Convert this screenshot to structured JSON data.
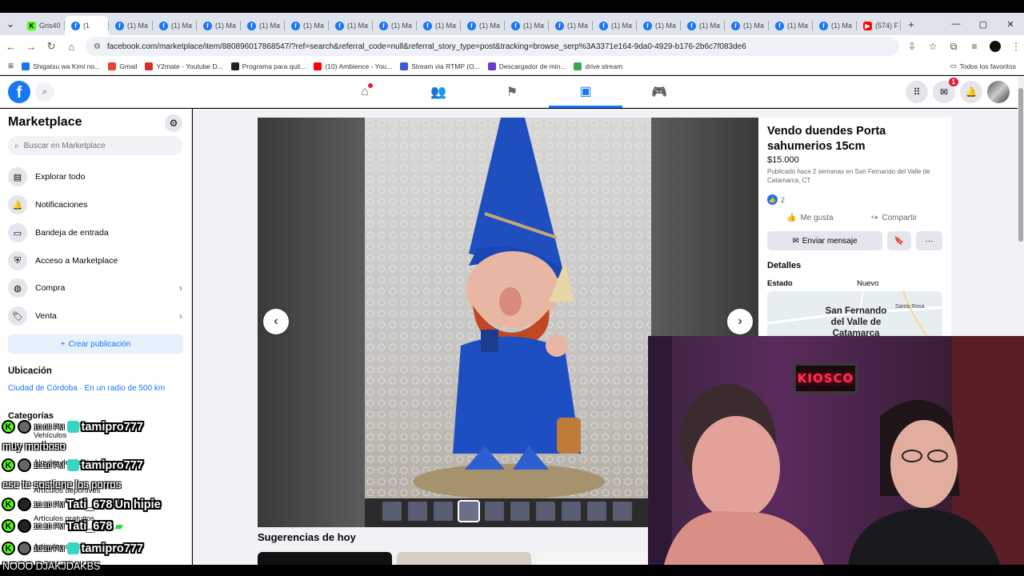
{
  "browser": {
    "tabs": [
      {
        "label": "Gris40",
        "icon": "kick"
      },
      {
        "label": "(1",
        "icon": "facebook",
        "active": true
      },
      {
        "label": "(1) Ma",
        "icon": "facebook"
      },
      {
        "label": "(1) Ma",
        "icon": "facebook"
      },
      {
        "label": "(1) Ma",
        "icon": "facebook"
      },
      {
        "label": "(1) Ma",
        "icon": "facebook"
      },
      {
        "label": "(1) Ma",
        "icon": "facebook"
      },
      {
        "label": "(1) Ma",
        "icon": "facebook"
      },
      {
        "label": "(1) Ma",
        "icon": "facebook"
      },
      {
        "label": "(1) Ma",
        "icon": "facebook"
      },
      {
        "label": "(1) Ma",
        "icon": "facebook"
      },
      {
        "label": "(1) Ma",
        "icon": "facebook"
      },
      {
        "label": "(1) Ma",
        "icon": "facebook"
      },
      {
        "label": "(1) Ma",
        "icon": "facebook"
      },
      {
        "label": "(1) Ma",
        "icon": "facebook"
      },
      {
        "label": "(1) Ma",
        "icon": "facebook"
      },
      {
        "label": "(1) Ma",
        "icon": "facebook"
      },
      {
        "label": "(1) Ma",
        "icon": "facebook"
      },
      {
        "label": "(1) Ma",
        "icon": "facebook"
      },
      {
        "label": "(574) F",
        "icon": "youtube"
      }
    ],
    "new_tab": "+",
    "url": "facebook.com/marketplace/item/880896017868547/?ref=search&referral_code=null&referral_story_type=post&tracking=browse_serp%3A3371e164-9da0-4929-b176-2b6c7f083de6",
    "bookmarks": [
      {
        "label": "Shigatsu wa Kimi no...",
        "color": "#1877f2"
      },
      {
        "label": "Gmail",
        "color": "#ea4335"
      },
      {
        "label": "Y2mate - Youtube D...",
        "color": "#d93025"
      },
      {
        "label": "Programa para quit...",
        "color": "#222222"
      },
      {
        "label": "(10) Ambience - You...",
        "color": "#ff0000"
      },
      {
        "label": "Stream via RTMP (O...",
        "color": "#3b5bdb"
      },
      {
        "label": "Descargador de min...",
        "color": "#6a3dd1"
      },
      {
        "label": "drive stream",
        "color": "#34a853"
      }
    ],
    "bookmarks_all": "Todos los favoritos"
  },
  "fb": {
    "logo": "f",
    "messenger_badge": "1"
  },
  "sidebar": {
    "title": "Marketplace",
    "search_placeholder": "Buscar en Marketplace",
    "items": [
      {
        "label": "Explorar todo",
        "icon": "store-icon"
      },
      {
        "label": "Notificaciones",
        "icon": "bell-icon"
      },
      {
        "label": "Bandeja de entrada",
        "icon": "inbox-icon"
      },
      {
        "label": "Acceso a Marketplace",
        "icon": "shield-icon"
      },
      {
        "label": "Compra",
        "icon": "bag-icon"
      },
      {
        "label": "Venta",
        "icon": "tag-icon"
      }
    ],
    "create": "Crear publicación",
    "location_title": "Ubicación",
    "location_value": "Ciudad de Córdoba · En un radio de 500 km",
    "categories_title": "Categorías",
    "categories": [
      "Vehículos",
      "Alquiler de propiedades",
      "Artículos deportivos",
      "Artículos gratuitos",
      "Artículos de..."
    ]
  },
  "listing": {
    "title": "Vendo duendes Porta sahumerios 15cm",
    "price": "$15.000",
    "published": "Publicado hace 2 semanas en San Fernando del Valle de Catamarca, CT",
    "likes": "2",
    "like_label": "Me gusta",
    "share_label": "Compartir",
    "message_label": "Enviar mensaje",
    "details_title": "Detalles",
    "state_label": "Estado",
    "state_value": "Nuevo",
    "map_city": "San Fernando del Valle de Catamarca",
    "map_nearby": "Santa Rosa",
    "suggestions_title": "Sugerencias de hoy"
  },
  "stream": {
    "kiosco": "KIOSCO",
    "chat": [
      {
        "time": "10:09 PM",
        "user": "tamipro777",
        "message": "muy morboso"
      },
      {
        "time": "10:10 PM",
        "user": "tamipro777",
        "message": "ese te sostiene los porros"
      },
      {
        "time": "10:10 PM",
        "user": "Tati_678",
        "message": "Un hipie"
      },
      {
        "time": "10:10 PM",
        "user": "Tati_678",
        "message": ""
      },
      {
        "time": "10:10 PM",
        "user": "tamipro777",
        "message": "NOOO DJAKJDAKBS"
      }
    ]
  }
}
